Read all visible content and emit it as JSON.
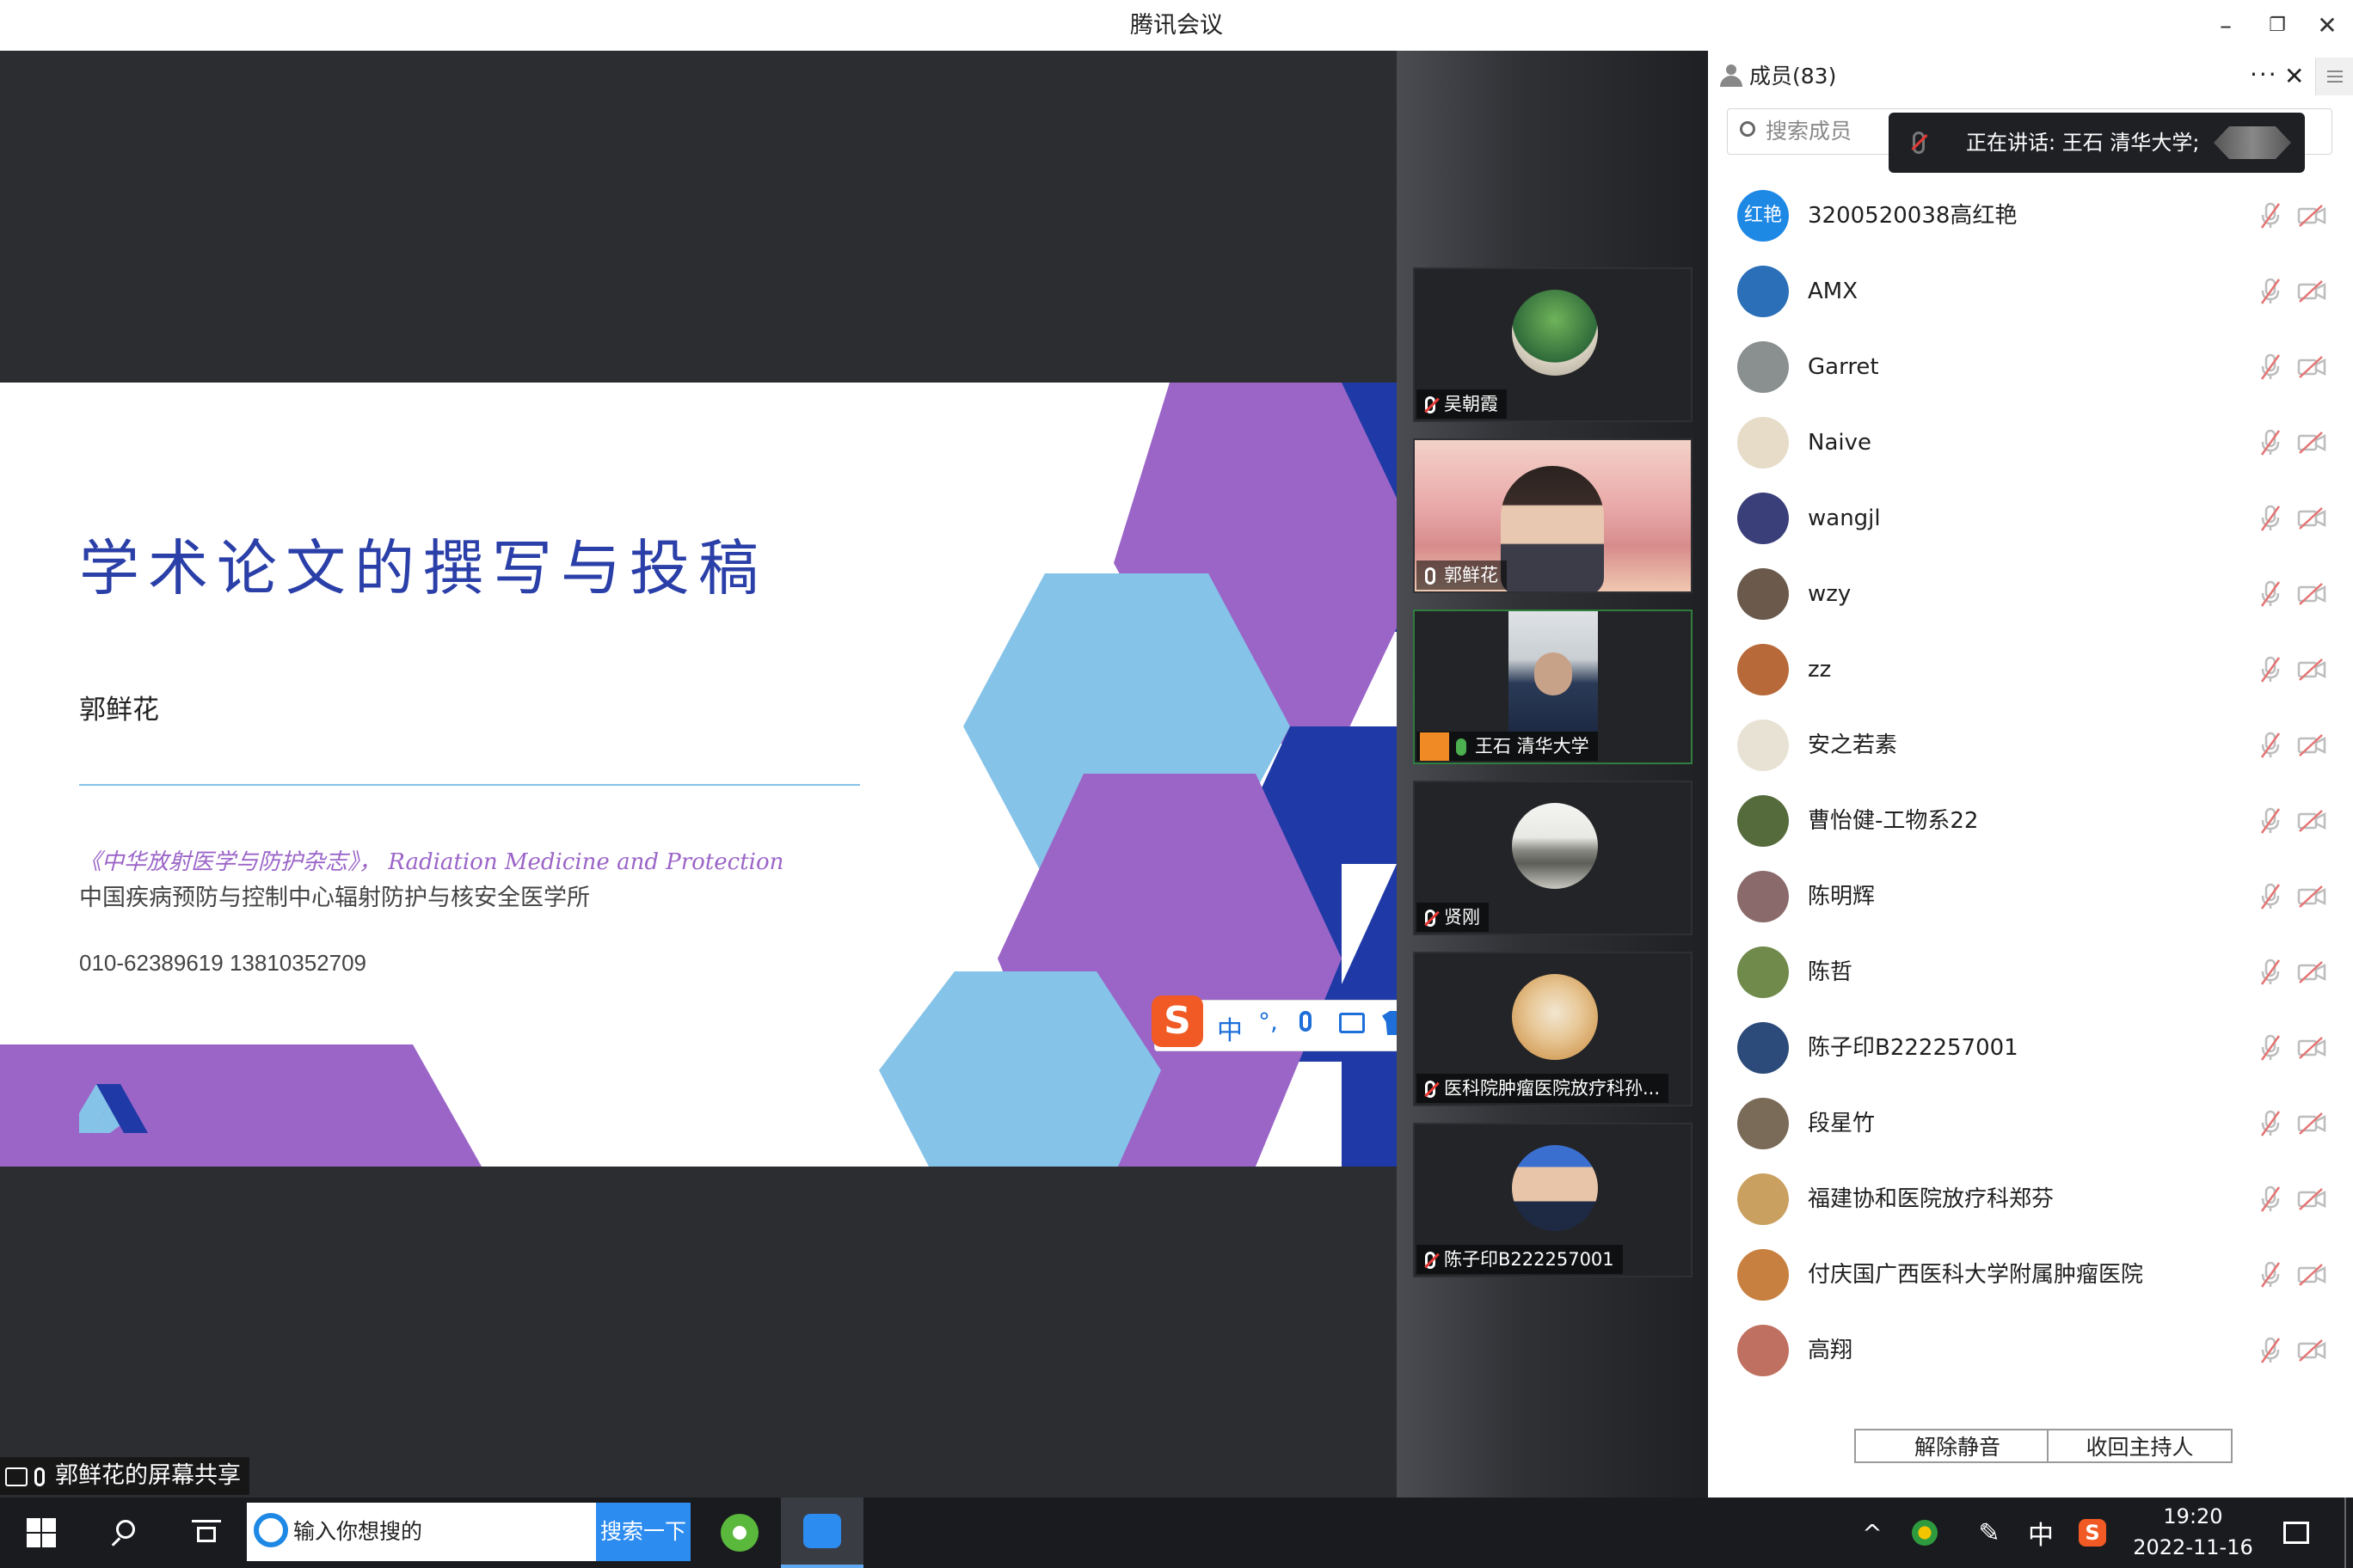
{
  "window": {
    "title": "腾讯会议"
  },
  "share": {
    "label": "郭鲜花的屏幕共享",
    "slide": {
      "title": "学术论文的撰写与投稿",
      "author": "郭鲜花",
      "journal": "《中华放射医学与防护杂志》， Radiation Medicine and Protection",
      "org": "中国疾病预防与控制中心辐射防护与核安全医学所",
      "phone": "010-62389619 13810352709"
    }
  },
  "ime": {
    "lang": "中",
    "punct": "°,"
  },
  "video_tiles": [
    {
      "name": "吴朝霞",
      "mic": "muted"
    },
    {
      "name": "郭鲜花",
      "mic": "on"
    },
    {
      "name": "王石 清华大学",
      "mic": "on"
    },
    {
      "name": "贤刚",
      "mic": "muted"
    },
    {
      "name": "医科院肿瘤医院放疗科孙...",
      "mic": "muted"
    },
    {
      "name": "陈子印B222257001",
      "mic": "muted"
    }
  ],
  "members": {
    "title": "成员(83)",
    "search_placeholder": "搜索成员",
    "speaking": "正在讲话: 王石 清华大学;",
    "list": [
      {
        "name": "3200520038高红艳",
        "avatar_text": "红艳",
        "color": "#1e88e5"
      },
      {
        "name": "AMX",
        "color": "#2a6fb8"
      },
      {
        "name": "Garret",
        "color": "#8a8f90"
      },
      {
        "name": "Naive",
        "color": "#e6dcc8"
      },
      {
        "name": "wangjl",
        "color": "#3a3f7a"
      },
      {
        "name": "wzy",
        "color": "#6b5a4c"
      },
      {
        "name": "zz",
        "color": "#b8693a"
      },
      {
        "name": "安之若素",
        "color": "#e8e2d4"
      },
      {
        "name": "曹怡健-工物系22",
        "color": "#556b3c"
      },
      {
        "name": "陈明辉",
        "color": "#8a6a6a"
      },
      {
        "name": "陈哲",
        "color": "#6f8a4a"
      },
      {
        "name": "陈子印B222257001",
        "color": "#2c4a7a"
      },
      {
        "name": "段星竹",
        "color": "#7a6a58"
      },
      {
        "name": "福建协和医院放疗科郑芬",
        "color": "#c9a060"
      },
      {
        "name": "付庆国广西医科大学附属肿瘤医院",
        "color": "#c88040"
      },
      {
        "name": "高翔",
        "color": "#c07060"
      }
    ],
    "unmute_button": "解除静音",
    "reclaim_host_button": "收回主持人"
  },
  "taskbar": {
    "search_placeholder": "输入你想搜的",
    "search_button": "搜索一下",
    "ime_lang": "中",
    "time": "19:20",
    "date": "2022-11-16"
  },
  "colors": {
    "slide_title": "#2a3fa8",
    "purple": "#9b65c8",
    "light_blue": "#86c3e8",
    "dark_blue": "#1f3aa6",
    "active_tile_border": "#2f7d3f"
  }
}
